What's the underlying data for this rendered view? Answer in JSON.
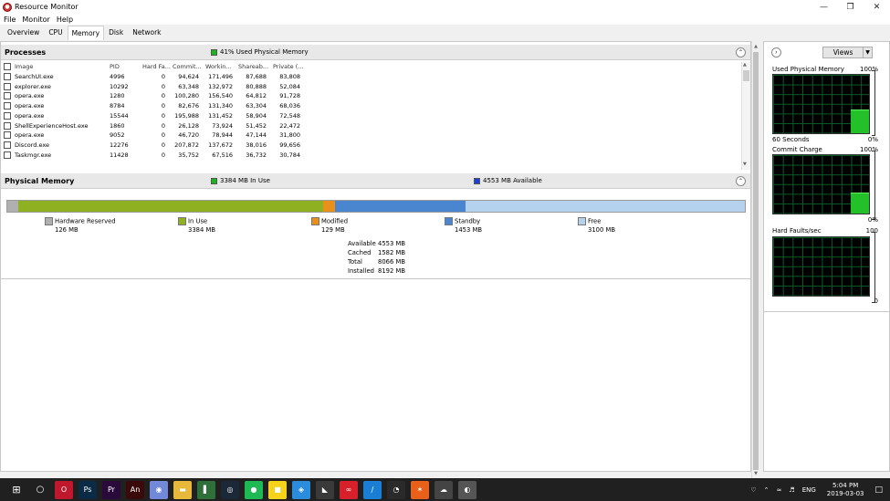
{
  "window": {
    "title": "Resource Monitor",
    "minimize": "—",
    "restore": "❐",
    "close": "✕"
  },
  "menu": [
    "File",
    "Monitor",
    "Help"
  ],
  "tabs": [
    {
      "label": "Overview",
      "active": false
    },
    {
      "label": "CPU",
      "active": false
    },
    {
      "label": "Memory",
      "active": true
    },
    {
      "label": "Disk",
      "active": false
    },
    {
      "label": "Network",
      "active": false
    }
  ],
  "processes": {
    "title": "Processes",
    "status": "41% Used Physical Memory",
    "columns": [
      "Image",
      "PID",
      "Hard Fa...",
      "Commit...",
      "Workin...",
      "Shareab...",
      "Private (..."
    ],
    "rows": [
      [
        "SearchUI.exe",
        "4996",
        "0",
        "94,624",
        "171,496",
        "87,688",
        "83,808"
      ],
      [
        "explorer.exe",
        "10292",
        "0",
        "63,348",
        "132,972",
        "80,888",
        "52,084"
      ],
      [
        "opera.exe",
        "1280",
        "0",
        "100,280",
        "156,540",
        "64,812",
        "91,728"
      ],
      [
        "opera.exe",
        "8784",
        "0",
        "82,676",
        "131,340",
        "63,304",
        "68,036"
      ],
      [
        "opera.exe",
        "15544",
        "0",
        "195,988",
        "131,452",
        "58,904",
        "72,548"
      ],
      [
        "ShellExperienceHost.exe",
        "1860",
        "0",
        "26,128",
        "73,924",
        "51,452",
        "22,472"
      ],
      [
        "opera.exe",
        "9052",
        "0",
        "46,720",
        "78,944",
        "47,144",
        "31,800"
      ],
      [
        "Discord.exe",
        "12276",
        "0",
        "207,872",
        "137,672",
        "38,016",
        "99,656"
      ],
      [
        "Taskmgr.exe",
        "11428",
        "0",
        "35,752",
        "67,516",
        "36,732",
        "30,784"
      ]
    ]
  },
  "physical": {
    "title": "Physical Memory",
    "in_use_status": "3384 MB In Use",
    "available_status": "4553 MB Available",
    "bar": [
      {
        "key": "hardware",
        "fraction": 0.0154,
        "color": "#b0b0b0"
      },
      {
        "key": "inuse",
        "fraction": 0.413,
        "color": "#8fb021"
      },
      {
        "key": "modified",
        "fraction": 0.0157,
        "color": "#e8901a"
      },
      {
        "key": "standby",
        "fraction": 0.1774,
        "color": "#4a86cf"
      },
      {
        "key": "free",
        "fraction": 0.3784,
        "color": "#b4d2ee"
      }
    ],
    "legend": [
      {
        "label": "Hardware Reserved",
        "value": "126 MB",
        "color": "#b0b0b0"
      },
      {
        "label": "In Use",
        "value": "3384 MB",
        "color": "#8fb021"
      },
      {
        "label": "Modified",
        "value": "129 MB",
        "color": "#e8901a"
      },
      {
        "label": "Standby",
        "value": "1453 MB",
        "color": "#4a86cf"
      },
      {
        "label": "Free",
        "value": "3100 MB",
        "color": "#b4d2ee"
      }
    ],
    "summary": [
      {
        "k": "Available",
        "v": "4553 MB"
      },
      {
        "k": "Cached",
        "v": "1582 MB"
      },
      {
        "k": "Total",
        "v": "8066 MB"
      },
      {
        "k": "Installed",
        "v": "8192 MB"
      }
    ]
  },
  "side": {
    "views_label": "Views",
    "graph1": {
      "label": "Used Physical Memory",
      "max": "100%",
      "time": "60 Seconds",
      "min": "0%",
      "level": 0.41
    },
    "graph2": {
      "label": "Commit Charge",
      "max": "100%",
      "min": "0%",
      "level": 0.36
    },
    "graph3": {
      "label": "Hard Faults/sec",
      "max": "100",
      "min": "0",
      "level": 0
    }
  },
  "taskbar": {
    "apps": [
      {
        "name": "opera-icon",
        "glyph": "O",
        "bg": "#c0172c"
      },
      {
        "name": "photoshop-icon",
        "glyph": "Ps",
        "bg": "#0b2a45"
      },
      {
        "name": "premiere-icon",
        "glyph": "Pr",
        "bg": "#2a0a3a"
      },
      {
        "name": "animate-icon",
        "glyph": "An",
        "bg": "#3a0a0a"
      },
      {
        "name": "discord-icon",
        "glyph": "◉",
        "bg": "#7289da"
      },
      {
        "name": "file-explorer-icon",
        "glyph": "▬",
        "bg": "#e8b83a"
      },
      {
        "name": "book-app-icon",
        "glyph": "▌",
        "bg": "#2f6f3a"
      },
      {
        "name": "steam-icon",
        "glyph": "◎",
        "bg": "#1b2838"
      },
      {
        "name": "spotify-icon",
        "glyph": "●",
        "bg": "#1db954"
      },
      {
        "name": "sticky-notes-icon",
        "glyph": "■",
        "bg": "#f7d21a"
      },
      {
        "name": "blue-app-icon",
        "glyph": "◈",
        "bg": "#2b8cdc"
      },
      {
        "name": "nvidia-icon",
        "glyph": "◣",
        "bg": "#3a3a3a"
      },
      {
        "name": "creative-cloud-icon",
        "glyph": "∞",
        "bg": "#d8202a"
      },
      {
        "name": "pen-app-icon",
        "glyph": "∕",
        "bg": "#1a7fd4"
      },
      {
        "name": "speedometer-icon",
        "glyph": "◔",
        "bg": "#2a2a2a"
      },
      {
        "name": "orange-app-icon",
        "glyph": "✶",
        "bg": "#e8601a"
      },
      {
        "name": "cloud-app-icon",
        "glyph": "☁",
        "bg": "#444"
      },
      {
        "name": "resource-monitor-icon",
        "glyph": "◐",
        "bg": "#555"
      }
    ],
    "lang": "ENG",
    "time": "5:04 PM",
    "date": "2019-03-03"
  }
}
